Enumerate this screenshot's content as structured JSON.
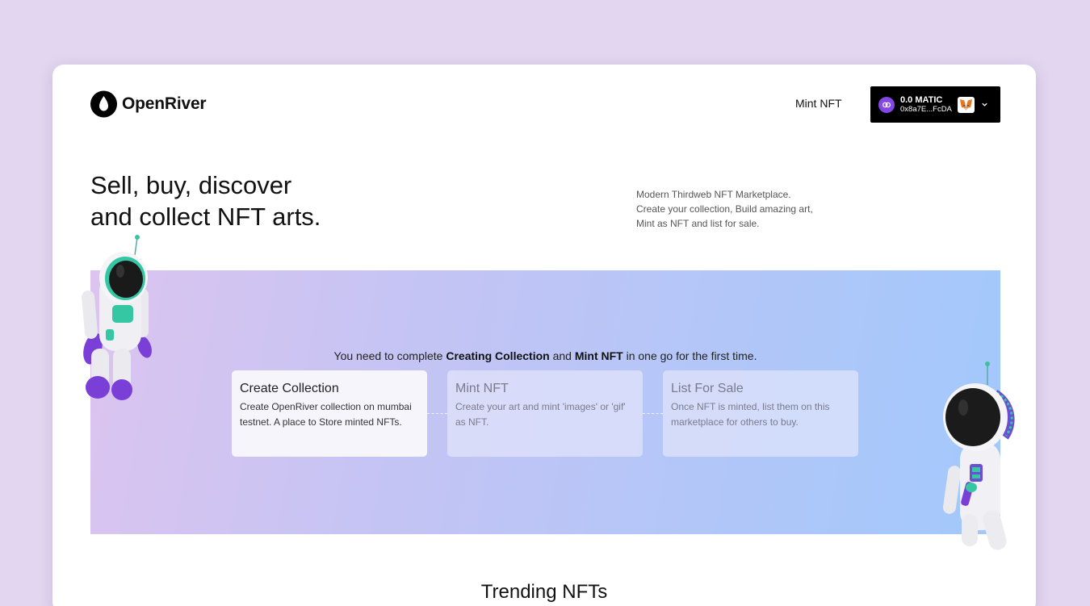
{
  "header": {
    "brand": "OpenRiver",
    "nav_mint": "Mint NFT",
    "wallet": {
      "balance": "0.0 MATIC",
      "address": "0x8a7E...FcDA"
    }
  },
  "hero": {
    "title_line1": "Sell, buy, discover",
    "title_line2": "and collect NFT arts.",
    "desc_line1": "Modern Thirdweb NFT Marketplace.",
    "desc_line2": "Create your collection, Build amazing art,",
    "desc_line3": "Mint as NFT and list for sale."
  },
  "banner": {
    "msg_pre": "You need to complete ",
    "msg_b1": "Creating Collection",
    "msg_mid": " and ",
    "msg_b2": "Mint NFT",
    "msg_post": " in one go for the first time.",
    "steps": [
      {
        "title": "Create Collection",
        "desc": "Create OpenRiver collection on mumbai testnet. A place to Store minted NFTs."
      },
      {
        "title": "Mint NFT",
        "desc": "Create your art and mint 'images' or 'gif' as NFT."
      },
      {
        "title": "List For Sale",
        "desc": "Once NFT is minted, list them on this marketplace for others to buy."
      }
    ]
  },
  "trending_title": "Trending NFTs",
  "colors": {
    "page_bg": "#e3d6f0",
    "wallet_bg": "#000000",
    "matic": "#8247e5",
    "banner_start": "#dcc4ef",
    "banner_end": "#a2c8fb"
  }
}
